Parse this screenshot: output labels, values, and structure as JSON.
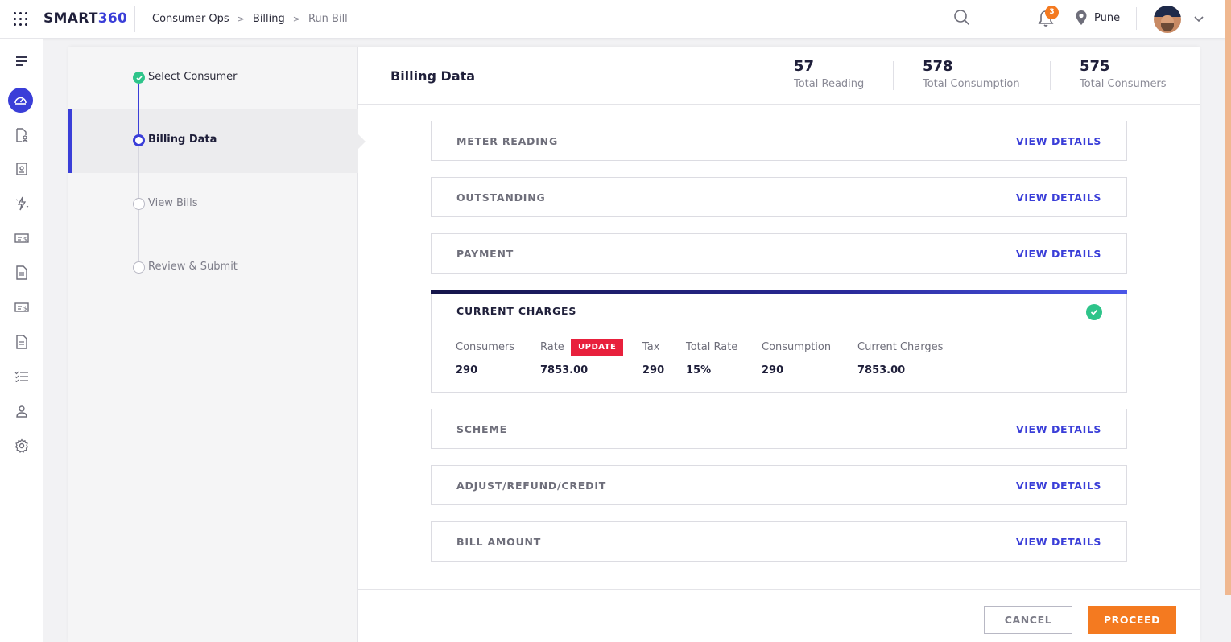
{
  "app": {
    "logo_part1": "SMART",
    "logo_part2": "360"
  },
  "breadcrumb": [
    "Consumer Ops",
    "Billing",
    "Run Bill"
  ],
  "breadcrumb_sep": ">",
  "header": {
    "notification_count": "3",
    "location": "Pune"
  },
  "colors": {
    "accent": "#3a3ed8",
    "orange": "#f47a20",
    "success": "#2ec48a",
    "danger": "#e8203c"
  },
  "sidebar_icons": [
    "menu-icon",
    "dashboard-icon",
    "consumer-file-icon",
    "id-card-icon",
    "meter-spark-icon",
    "billing-card-icon",
    "document-icon",
    "payment-card-icon",
    "report-icon",
    "checklist-icon",
    "user-icon",
    "settings-icon"
  ],
  "steps": [
    {
      "label": "Select Consumer",
      "state": "done"
    },
    {
      "label": "Billing Data",
      "state": "current"
    },
    {
      "label": "View Bills",
      "state": "pending"
    },
    {
      "label": "Review & Submit",
      "state": "pending"
    }
  ],
  "content": {
    "title": "Billing Data",
    "stats": [
      {
        "value": "57",
        "label": "Total Reading"
      },
      {
        "value": "578",
        "label": "Total Consumption"
      },
      {
        "value": "575",
        "label": "Total Consumers"
      }
    ]
  },
  "panels": [
    {
      "title": "METER READING",
      "action": "VIEW DETAILS"
    },
    {
      "title": "OUTSTANDING",
      "action": "VIEW DETAILS"
    },
    {
      "title": "PAYMENT",
      "action": "VIEW DETAILS"
    },
    {
      "title": "SCHEME",
      "action": "VIEW DETAILS"
    },
    {
      "title": "ADJUST/REFUND/CREDIT",
      "action": "VIEW DETAILS"
    },
    {
      "title": "BILL AMOUNT",
      "action": "VIEW DETAILS"
    }
  ],
  "current_charges": {
    "title": "CURRENT CHARGES",
    "update_label": "UPDATE",
    "columns": [
      {
        "label": "Consumers",
        "value": "290"
      },
      {
        "label": "Rate",
        "value": "7853.00"
      },
      {
        "label": "Tax",
        "value": "290"
      },
      {
        "label": "Total Rate",
        "value": "15%"
      },
      {
        "label": "Consumption",
        "value": "290"
      },
      {
        "label": "Current Charges",
        "value": "7853.00"
      }
    ]
  },
  "footer": {
    "cancel_label": "CANCEL",
    "proceed_label": "PROCEED"
  }
}
